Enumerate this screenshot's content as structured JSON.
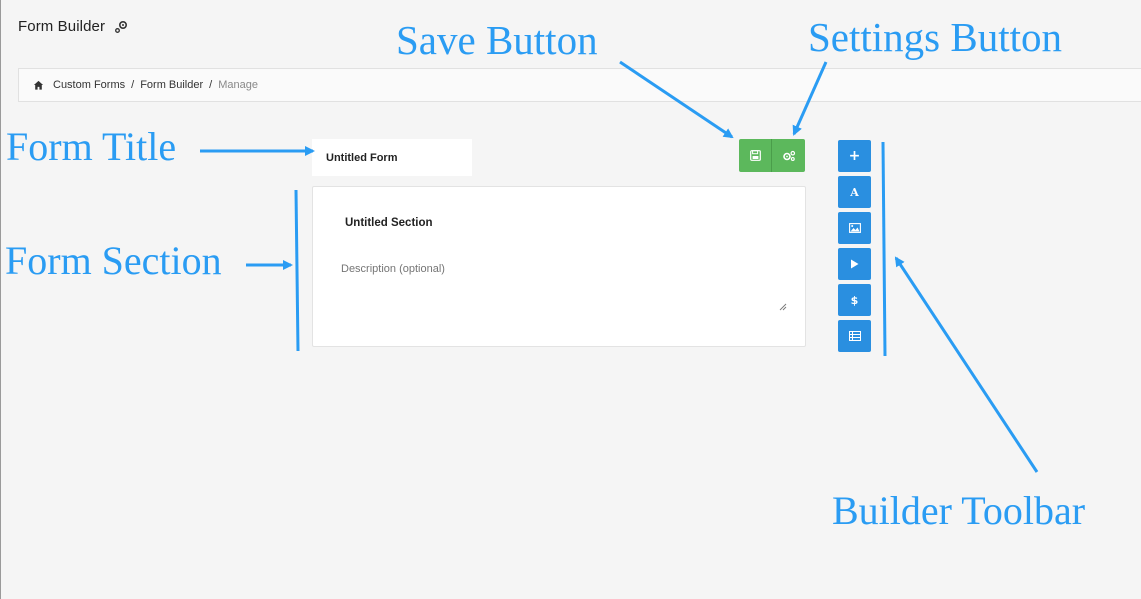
{
  "page": {
    "title": "Form Builder"
  },
  "breadcrumb": {
    "items": [
      "Custom Forms",
      "Form Builder",
      "Manage"
    ],
    "separator": "/"
  },
  "form": {
    "title": "Untitled Form",
    "section": {
      "title": "Untitled Section",
      "description_placeholder": "Description (optional)"
    }
  },
  "actions": {
    "save_icon": "save-icon",
    "settings_icon": "gears-icon"
  },
  "toolbar": {
    "buttons": [
      {
        "icon": "plus-icon",
        "glyph": "+"
      },
      {
        "icon": "text-icon",
        "glyph": "A"
      },
      {
        "icon": "image-icon",
        "glyph": ""
      },
      {
        "icon": "video-icon",
        "glyph": ""
      },
      {
        "icon": "dollar-icon",
        "glyph": "$"
      },
      {
        "icon": "list-icon",
        "glyph": ""
      }
    ]
  },
  "annotations": {
    "save_button": "Save Button",
    "settings_button": "Settings Button",
    "form_title": "Form Title",
    "form_section": "Form Section",
    "builder_toolbar": "Builder Toolbar"
  },
  "colors": {
    "background": "#f5f5f5",
    "green": "#5cb85c",
    "blue": "#2a8fe0",
    "annotation": "#2a9cf3"
  }
}
